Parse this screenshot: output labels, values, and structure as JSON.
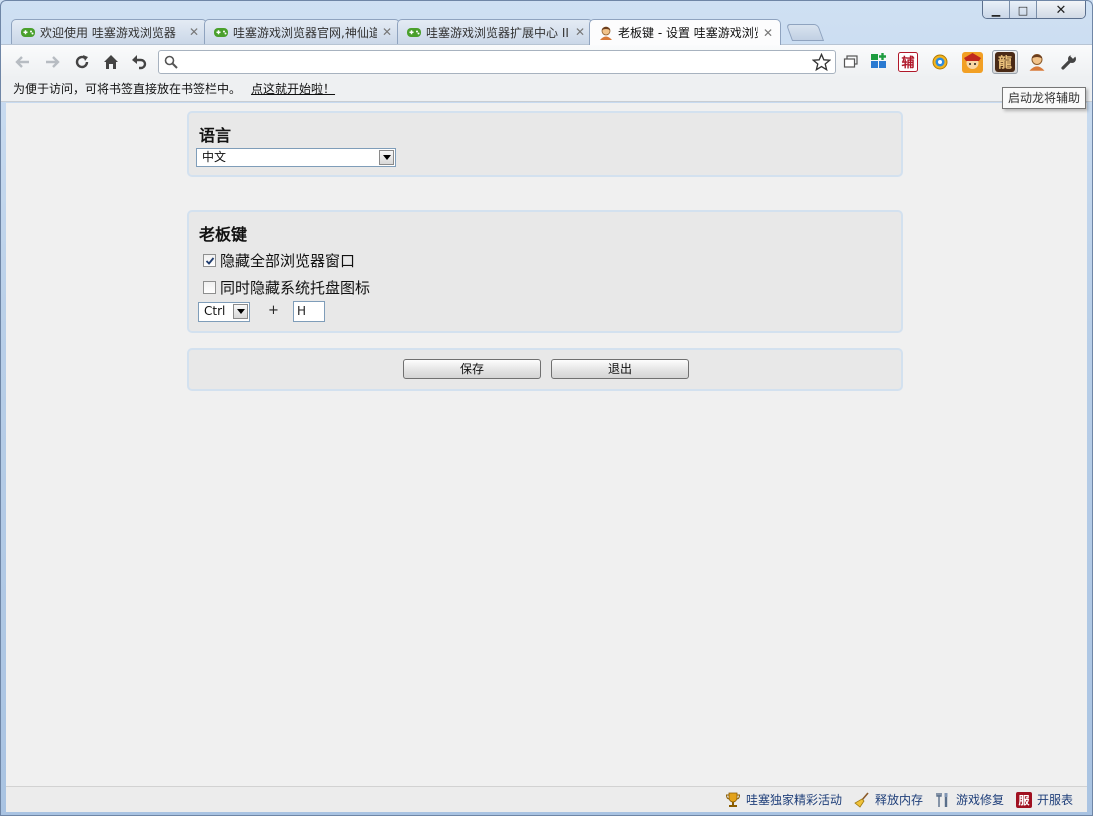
{
  "window": {
    "minimize_glyph": "▁",
    "maximize_glyph": "□",
    "close_glyph": "✕"
  },
  "tabs": [
    {
      "title": "欢迎使用 哇塞游戏浏览器",
      "icon": "gamepad-icon",
      "active": false
    },
    {
      "title": "哇塞游戏浏览器官网,神仙道",
      "icon": "gamepad-icon",
      "active": false
    },
    {
      "title": "哇塞游戏浏览器扩展中心 II",
      "icon": "gamepad-icon",
      "active": false
    },
    {
      "title": "老板键 - 设置 哇塞游戏浏览",
      "icon": "person-icon",
      "active": true
    }
  ],
  "toolbar": {
    "omnibox_value": "",
    "extensions": [
      "window-icon",
      "apps-icon",
      "fu-icon",
      "gear-icon",
      "game-avatar-icon",
      "long-icon",
      "person-icon",
      "wrench-icon"
    ],
    "ext_fu_text": "辅",
    "ext_long_text": "龍"
  },
  "bookmarkbar": {
    "hint": "为便于访问，可将书签直接放在书签栏中。",
    "link": "点这就开始啦！"
  },
  "tooltip": "启动龙将辅助",
  "settings": {
    "language": {
      "title": "语言",
      "selected": "中文"
    },
    "bosskey": {
      "title": "老板键",
      "hide_windows_label": "隐藏全部浏览器窗口",
      "hide_windows_checked": true,
      "hide_tray_label": "同时隐藏系统托盘图标",
      "hide_tray_checked": false,
      "modifier": "Ctrl",
      "plus": "+",
      "key": "H"
    },
    "actions": {
      "save_label": "保存",
      "exit_label": "退出"
    }
  },
  "statusbar": {
    "items": [
      {
        "label": "哇塞独家精彩活动",
        "icon": "trophy-icon"
      },
      {
        "label": "释放内存",
        "icon": "broom-icon"
      },
      {
        "label": "游戏修复",
        "icon": "tools-icon"
      },
      {
        "label": "开服表",
        "icon": "server-list-icon",
        "glyph": "服"
      }
    ]
  },
  "colors": {
    "panel_border": "#d3e1ef",
    "status_text": "#1f3f7a",
    "fu_red": "#b0182a"
  }
}
